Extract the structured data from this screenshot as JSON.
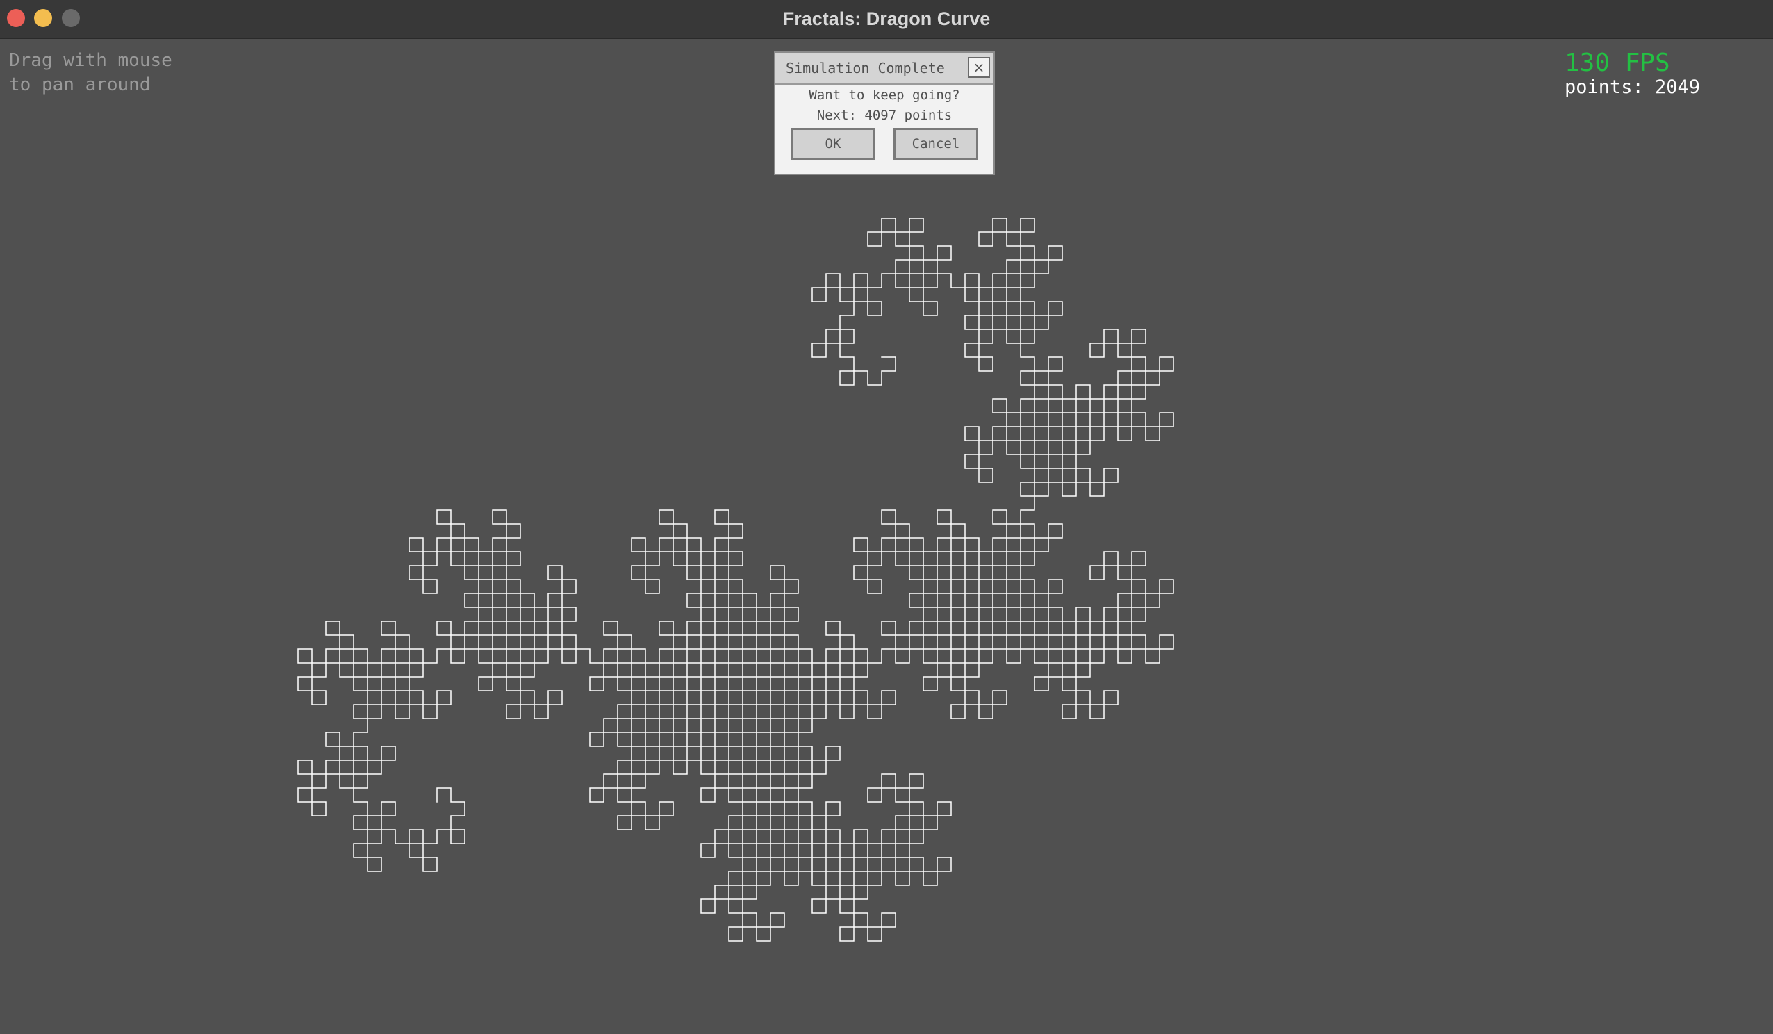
{
  "window": {
    "title": "Fractals: Dragon Curve"
  },
  "overlay": {
    "hint": "Drag with mouse\nto pan around",
    "fps": "130 FPS",
    "points": "points: 2049"
  },
  "dialog": {
    "title": "Simulation Complete",
    "close_glyph": "×",
    "message": "Want to keep going?",
    "next": "Next: 4097 points",
    "ok_label": "OK",
    "cancel_label": "Cancel"
  },
  "fractal": {
    "name": "dragon-curve",
    "iterations": 11,
    "line_color": "#ffffff"
  },
  "colors": {
    "background": "#505050",
    "fps": "#23c043",
    "points": "#ffffff"
  }
}
